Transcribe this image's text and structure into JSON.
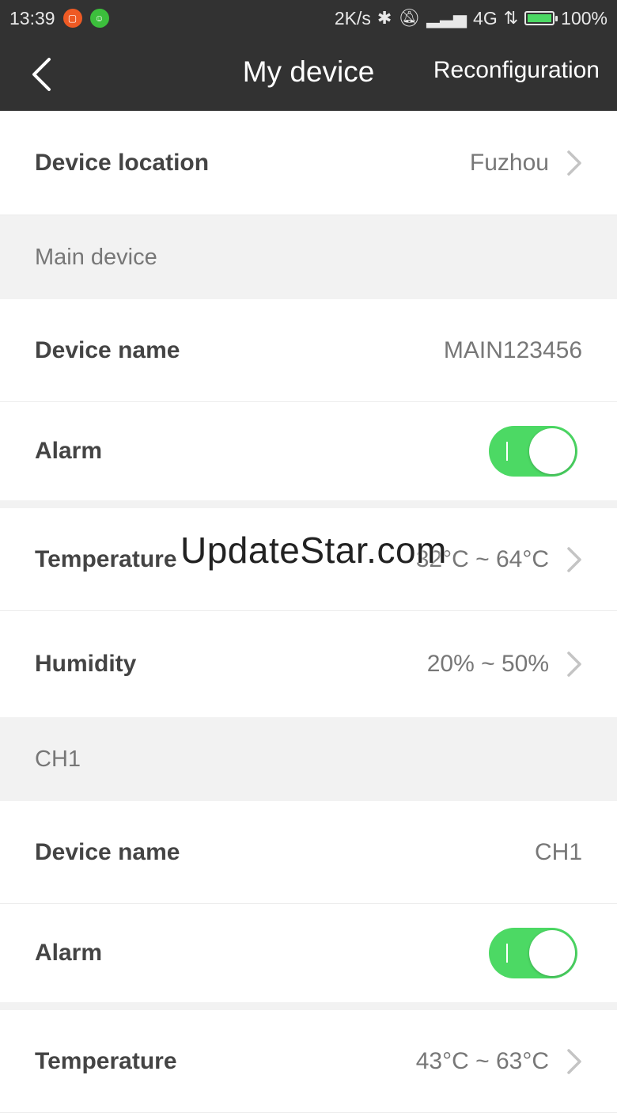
{
  "status_bar": {
    "time": "13:39",
    "speed": "2K/s",
    "network": "4G",
    "battery": "100%",
    "battery_level": 1.0
  },
  "header": {
    "title": "My device",
    "action": "Reconfiguration"
  },
  "location": {
    "label": "Device location",
    "value": "Fuzhou"
  },
  "main_device": {
    "section_title": "Main device",
    "device_name_label": "Device name",
    "device_name_value": "MAIN123456",
    "alarm_label": "Alarm",
    "alarm_on": true,
    "temperature_label": "Temperature",
    "temperature_value": "32°C ~ 64°C",
    "humidity_label": "Humidity",
    "humidity_value": "20% ~ 50%"
  },
  "ch1": {
    "section_title": "CH1",
    "device_name_label": "Device name",
    "device_name_value": "CH1",
    "alarm_label": "Alarm",
    "alarm_on": true,
    "temperature_label": "Temperature",
    "temperature_value": "43°C ~ 63°C"
  },
  "watermark": "UpdateStar.com",
  "colors": {
    "header_bg": "#323232",
    "toggle_on": "#4cd964"
  }
}
